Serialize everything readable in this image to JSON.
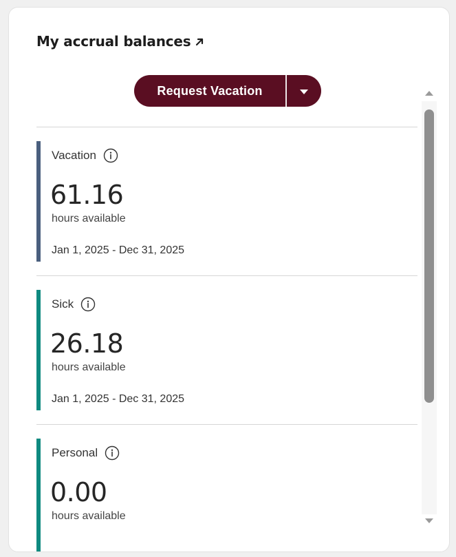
{
  "widget": {
    "title": "My accrual balances",
    "title_link_icon": "external-link-arrow-icon"
  },
  "actions": {
    "primary_label": "Request Vacation",
    "toggle_icon": "caret-down-icon",
    "button_color": "#5a0e22"
  },
  "balances": [
    {
      "label": "Vacation",
      "value": "61.16",
      "unit": "hours available",
      "period": "Jan 1, 2025 - Dec 31, 2025",
      "accent": "#4a5f7e"
    },
    {
      "label": "Sick",
      "value": "26.18",
      "unit": "hours available",
      "period": "Jan 1, 2025 - Dec 31, 2025",
      "accent": "#0f8a80"
    },
    {
      "label": "Personal",
      "value": "0.00",
      "unit": "hours available",
      "period": "",
      "accent": "#0f8a80"
    }
  ],
  "icons": {
    "info": "info-circle-icon",
    "scroll_up": "scroll-up-arrow-icon",
    "scroll_down": "scroll-down-arrow-icon"
  }
}
